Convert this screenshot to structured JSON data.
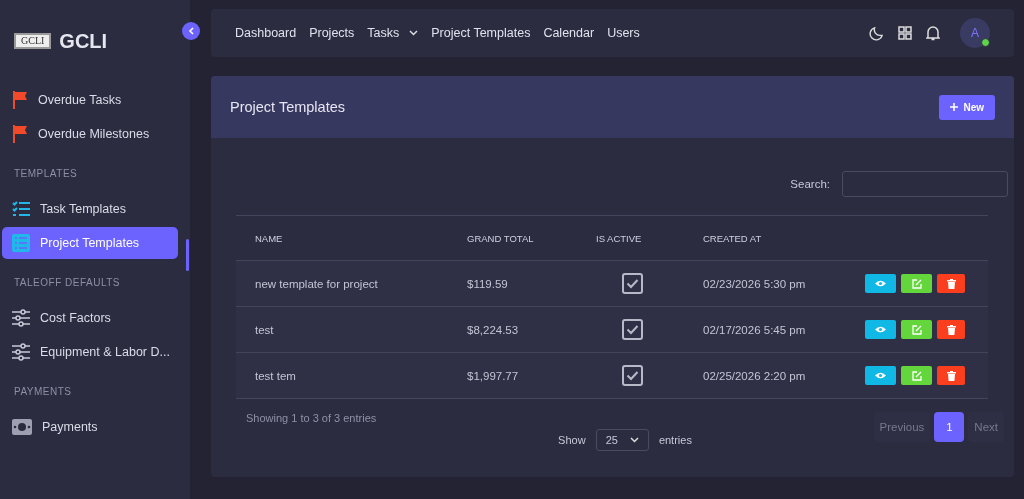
{
  "brand": {
    "logo_text": "GCLI",
    "name": "GCLI"
  },
  "sidebar": {
    "items": [
      {
        "kind": "item",
        "label": "Overdue Tasks",
        "selected": false
      },
      {
        "kind": "item",
        "label": "Overdue Milestones",
        "selected": false
      },
      {
        "kind": "section",
        "label": "TEMPLATES"
      },
      {
        "kind": "item",
        "label": "Task Templates",
        "selected": false
      },
      {
        "kind": "item",
        "label": "Project Templates",
        "selected": true
      },
      {
        "kind": "section",
        "label": "TALEOFF DEFAULTS"
      },
      {
        "kind": "item",
        "label": "Cost Factors",
        "selected": false
      },
      {
        "kind": "item",
        "label": "Equipment & Labor D...",
        "selected": false
      },
      {
        "kind": "section",
        "label": "PAYMENTS"
      },
      {
        "kind": "item",
        "label": "Payments",
        "selected": false
      }
    ]
  },
  "navbar": {
    "links": [
      {
        "label": "Dashboard",
        "dropdown": false
      },
      {
        "label": "Projects",
        "dropdown": false
      },
      {
        "label": "Tasks",
        "dropdown": true
      },
      {
        "label": "Project Templates",
        "dropdown": false
      },
      {
        "label": "Calendar",
        "dropdown": false
      },
      {
        "label": "Users",
        "dropdown": false
      }
    ],
    "avatar": "A",
    "online": true
  },
  "card": {
    "title": "Project Templates",
    "new_button": "New",
    "search_label": "Search:",
    "table": {
      "columns": [
        "NAME",
        "GRAND TOTAL",
        "IS ACTIVE",
        "CREATED AT"
      ],
      "rows": [
        {
          "name": "new template for project",
          "grand_total": "$119.59",
          "is_active": true,
          "created_at": "02/23/2026 5:30 pm"
        },
        {
          "name": "test",
          "grand_total": "$8,224.53",
          "is_active": true,
          "created_at": "02/17/2026 5:45 pm"
        },
        {
          "name": "test tem",
          "grand_total": "$1,997.77",
          "is_active": true,
          "created_at": "02/25/2026 2:20 pm"
        }
      ]
    },
    "info": "Showing 1 to 3 of 3 entries",
    "length": {
      "show": "Show",
      "value": "25",
      "entries": "entries"
    },
    "pagination": [
      {
        "label": "Previous",
        "selected": false,
        "disabled": true
      },
      {
        "label": "1",
        "selected": true,
        "disabled": false
      },
      {
        "label": "Next",
        "selected": false,
        "disabled": true
      }
    ]
  }
}
